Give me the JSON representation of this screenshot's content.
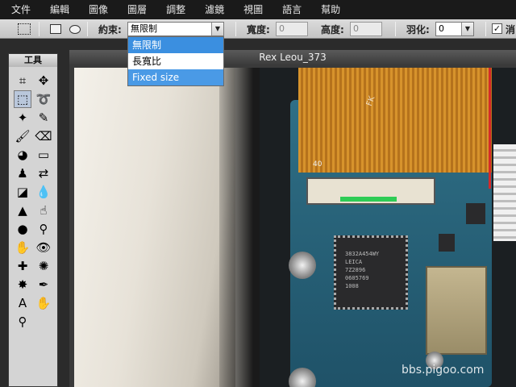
{
  "menu": [
    "文件",
    "編輯",
    "圖像",
    "圖層",
    "調整",
    "濾鏡",
    "視圖",
    "語言",
    "幫助"
  ],
  "options": {
    "constraint_label": "約束:",
    "constraint_value": "無限制",
    "width_label": "寬度:",
    "width_value": "0",
    "height_label": "高度:",
    "height_value": "0",
    "feather_label": "羽化:",
    "feather_value": "0",
    "checkbox_mark": "✓",
    "checkbox_label": "消"
  },
  "dropdown": {
    "items": [
      "無限制",
      "長寬比",
      "Fixed size"
    ],
    "selected_index": 0,
    "hover_index": 2
  },
  "tools": {
    "title": "工具",
    "items": [
      {
        "name": "crop-icon",
        "glyph": "⌗"
      },
      {
        "name": "move-icon",
        "glyph": "✥"
      },
      {
        "name": "marquee-icon",
        "glyph": "⬚"
      },
      {
        "name": "lasso-icon",
        "glyph": "➰"
      },
      {
        "name": "magic-wand-icon",
        "glyph": "✦"
      },
      {
        "name": "pencil-icon",
        "glyph": "✎"
      },
      {
        "name": "brush-icon",
        "glyph": "🖌"
      },
      {
        "name": "eraser-icon",
        "glyph": "⌫"
      },
      {
        "name": "paint-bucket-icon",
        "glyph": "◕"
      },
      {
        "name": "gradient-icon",
        "glyph": "▭"
      },
      {
        "name": "clone-stamp-icon",
        "glyph": "♟"
      },
      {
        "name": "color-replace-icon",
        "glyph": "⇄"
      },
      {
        "name": "drawing-shapes-icon",
        "glyph": "◪"
      },
      {
        "name": "blur-icon",
        "glyph": "💧"
      },
      {
        "name": "sharpen-icon",
        "glyph": "▲"
      },
      {
        "name": "smudge-icon",
        "glyph": "☝"
      },
      {
        "name": "sponge-icon",
        "glyph": "●"
      },
      {
        "name": "dodge-icon",
        "glyph": "⚲"
      },
      {
        "name": "burn-icon",
        "glyph": "✋"
      },
      {
        "name": "red-eye-icon",
        "glyph": "👁"
      },
      {
        "name": "spot-heal-icon",
        "glyph": "✚"
      },
      {
        "name": "bloat-icon",
        "glyph": "✺"
      },
      {
        "name": "pinch-icon",
        "glyph": "✸"
      },
      {
        "name": "color-picker-icon",
        "glyph": "✒"
      },
      {
        "name": "type-icon",
        "glyph": "A"
      },
      {
        "name": "hand-icon",
        "glyph": "✋"
      },
      {
        "name": "zoom-icon",
        "glyph": "⚲"
      }
    ]
  },
  "document": {
    "title": "Rex Leou_373",
    "watermark": "bbs.pigoo.com",
    "photo_texts": {
      "fk": "FK",
      "num": "40",
      "chip_lines": [
        "3832A454WY",
        "LEICA",
        "7Z2896",
        "0605769",
        "1008"
      ]
    }
  }
}
